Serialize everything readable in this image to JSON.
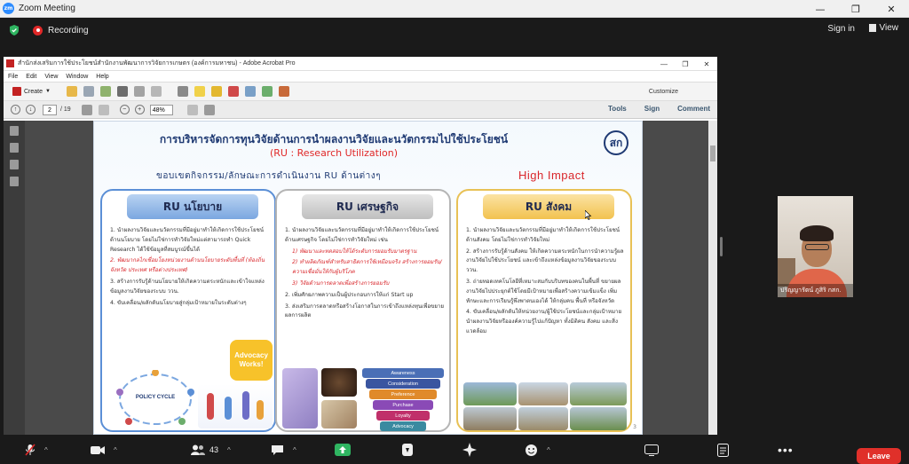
{
  "window": {
    "title": "Zoom Meeting",
    "logo": "zm"
  },
  "topbar": {
    "recording_label": "Recording",
    "sign_in": "Sign in",
    "view": "View"
  },
  "acrobat": {
    "title": "สำนักส่งเสริมการใช้ประโยชน์สำนักงานพัฒนาการวิจัยการเกษตร (องค์การมหาชน) - Adobe Acrobat Pro",
    "menu": [
      "File",
      "Edit",
      "View",
      "Window",
      "Help"
    ],
    "create_label": "Create",
    "customize_label": "Customize",
    "page_current": "2",
    "page_total": "/ 19",
    "zoom_value": "48%",
    "links": [
      "Tools",
      "Sign",
      "Comment"
    ]
  },
  "slide": {
    "title": "การบริหารจัดการทุนวิจัยด้านการนำผลงานวิจัยและนวัตกรรมไปใช้ประโยชน์",
    "subtitle": "(RU : Research Utilization)",
    "scope": "ขอบเขตกิจกรรม/ลักษณะการดำเนินงาน RU ด้านต่างๆ",
    "high_impact": "High Impact",
    "logo": "สก",
    "columns": [
      {
        "head": "RU นโยบาย",
        "items": [
          "1. นำผลงานวิจัยและนวัตกรรมที่มีอยู่มาทำให้เกิดการใช้ประโยชน์ด้านนโยบาย โดยไม่ใช่การทำวิจัยใหม่แต่สามารถทำ Quick Research ได้ใช้ข้อมูลที่สมบูรณ์ขึ้นได้",
          "2. พัฒนากลไกเชื่อมโยงหน่วยงานด้านนโยบายระดับพื้นที่ (ท้องถิ่น จังหวัด ประเทศ หรือต่างประเทศ)",
          "3. สร้างการรับรู้ด้านนโยบายให้เกิดความตระหนักและเข้าใจแหล่งข้อมูลงานวิจัยของระบบ ววน.",
          "4. ขับเคลื่อน/ผลักดันนโยบายสู่กลุ่มเป้าหมายในระดับต่างๆ"
        ],
        "figure_label": "POLICY CYCLE",
        "badge": "Advocacy Works!"
      },
      {
        "head": "RU เศรษฐกิจ",
        "items": [
          "1. นำผลงานวิจัยและนวัตกรรมที่มีอยู่มาทำให้เกิดการใช้ประโยชน์ด้านเศรษฐกิจ โดยไม่ใช่การทำวิจัยใหม่ เช่น",
          "1) พัฒนาและทดสอบให้ได้ระดับการยอมรับมาตรฐาน",
          "2) ทำผลิตภัณฑ์สำหรับสาธิตการใช้เหมือนจริง สร้างการยอมรับ/ความเชื่อมั่นให้กับผู้บริโภค",
          "3) วิจัยด้านการตลาดเพื่อสร้างการยอมรับ",
          "2. เพิ่มศักยภาพความเป็นผู้ประกอบการให้แก่ Start up",
          "3. ส่งเสริมการตลาดหรือสร้างโอกาสในการเข้าถึงแหล่งทุนเพื่อขยายผลการผลิต"
        ],
        "funnel": [
          "Awareness",
          "Consideration",
          "Preference",
          "Purchase",
          "Loyalty",
          "Advocacy"
        ]
      },
      {
        "head": "RU สังคม",
        "items": [
          "1. นำผลงานวิจัยและนวัตกรรมที่มีอยู่มาทำให้เกิดการใช้ประโยชน์ด้านสังคม โดยไม่ใช่การทำวิจัยใหม่",
          "2. สร้างการรับรู้ด้านสังคม ให้เกิดความตระหนักในการนำความรู้ผลงานวิจัยไปใช้ประโยชน์ และเข้าถึงแหล่งข้อมูลงานวิจัยของระบบ ววน.",
          "3. ถ่ายทอดเทคโนโลยีที่เหมาะสมกับบริบทของคนในพื้นที่ ขยายผลงานวิจัยไปประยุกต์ใช้โดยมีเป้าหมายเพื่อสร้างความเข้มแข็ง เพิ่มทักษะและการเรียนรู้พึ่งพาตนเองได้ ให้กลุ่มคน พื้นที่ หรือจังหวัด",
          "4. ขับเคลื่อน/ผลักดันให้หน่วยงาน/ผู้ใช้ประโยชน์และกลุ่มเป้าหมายนำผลงานวิจัยหรือองค์ความรู้ไปแก้ปัญหา ทั้งมิติคน สังคม และสิ่งแวดล้อม"
        ]
      }
    ],
    "page_number": "3"
  },
  "webcam": {
    "name": "ปริญญารัตน์ ภูสิริ กสก."
  },
  "bottom": {
    "participants_count": "43",
    "leave_label": "Leave"
  },
  "colors": {
    "accent": "#2d8cff",
    "recording": "#e02828",
    "leave": "#e0302a",
    "slide_title": "#1f3a73",
    "highlight_red": "#d9262b"
  }
}
